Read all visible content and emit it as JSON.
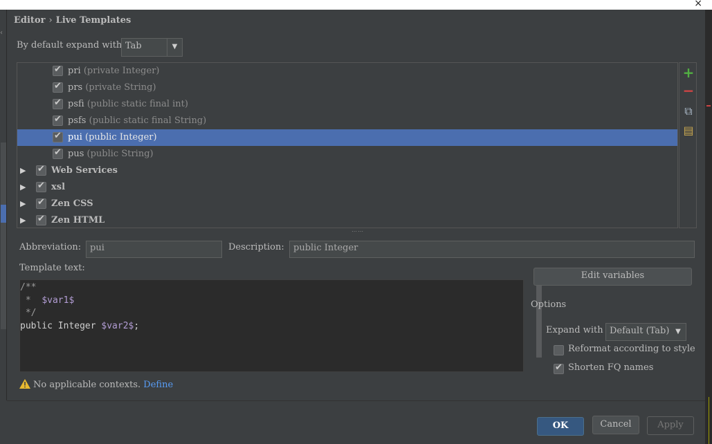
{
  "window": {
    "close_glyph": "×"
  },
  "breadcrumb": {
    "part1": "Editor",
    "separator": "›",
    "part2": "Live Templates"
  },
  "expand_default": {
    "label": "By default expand with",
    "value": "Tab"
  },
  "tree": {
    "rows": [
      {
        "abbr": "pri",
        "desc": "(private Integer)",
        "checked": true,
        "level": "child"
      },
      {
        "abbr": "prs",
        "desc": "(private String)",
        "checked": true,
        "level": "child"
      },
      {
        "abbr": "psfi",
        "desc": "(public static final int)",
        "checked": true,
        "level": "child"
      },
      {
        "abbr": "psfs",
        "desc": "(public static final String)",
        "checked": true,
        "level": "child"
      },
      {
        "abbr": "pui",
        "desc": "(public Integer)",
        "checked": true,
        "level": "child",
        "selected": true
      },
      {
        "abbr": "pus",
        "desc": "(public String)",
        "checked": true,
        "level": "child"
      },
      {
        "abbr": "Web Services",
        "desc": "",
        "checked": true,
        "level": "group"
      },
      {
        "abbr": "xsl",
        "desc": "",
        "checked": true,
        "level": "group"
      },
      {
        "abbr": "Zen CSS",
        "desc": "",
        "checked": true,
        "level": "group"
      },
      {
        "abbr": "Zen HTML",
        "desc": "",
        "checked": true,
        "level": "group"
      }
    ]
  },
  "toolbar": {
    "add_glyph": "+",
    "remove_glyph": "−",
    "copy_glyph": "⧉",
    "edit_glyph": "▤"
  },
  "abbreviation": {
    "label": "Abbreviation:",
    "value": "pui"
  },
  "description": {
    "label": "Description:",
    "value": "public Integer"
  },
  "template_text": {
    "label": "Template text:",
    "lines": [
      "/**",
      " *  $var1$",
      " */",
      "public Integer $var2$;"
    ]
  },
  "edit_variables_label": "Edit variables",
  "options": {
    "title": "Options",
    "expand_with_label": "Expand with",
    "expand_with_value": "Default (Tab)",
    "reformat_label": "Reformat according to style",
    "reformat_checked": false,
    "shorten_label": "Shorten FQ names",
    "shorten_checked": true
  },
  "warning": {
    "text": "No applicable contexts.",
    "link": "Define"
  },
  "buttons": {
    "ok": "OK",
    "cancel": "Cancel",
    "apply": "Apply"
  }
}
